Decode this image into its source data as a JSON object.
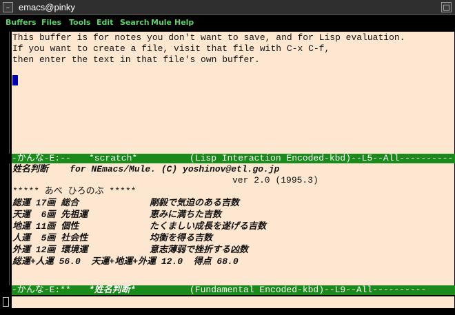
{
  "window": {
    "title": "emacs@pinky",
    "menu_button_glyph": "–",
    "close_button_glyph": "□"
  },
  "menubar": {
    "items": [
      "Buffers",
      "Files",
      "Tools",
      "Edit",
      "Search",
      "Mule",
      "Help"
    ]
  },
  "scratch_buffer": {
    "lines": [
      "This buffer is for notes you don't want to save, and for Lisp evaluation.",
      "If you want to create a file, visit that file with C-x C-f,",
      "then enter the text in that file's own buffer."
    ]
  },
  "modeline_top": {
    "status": "-かんな-E:--",
    "buffer": "*scratch*",
    "mode": "(Lisp Interaction Encoded-kbd)--L5--All----------"
  },
  "seimei_buffer": {
    "header_line": "姓名判断    for NEmacs/Mule. (C) yoshinov@etl.go.jp",
    "version_line": "ver 2.0 (1995.3)",
    "name_line": "***** あべ ひろのぶ *****",
    "rows": [
      {
        "label": "総運 17画 総合",
        "desc": "剛毅で気迫のある吉数"
      },
      {
        "label": "天運  6画 先祖運",
        "desc": "恵みに満ちた吉数"
      },
      {
        "label": "地運 11画 個性",
        "desc": "たくましい成長を遂げる吉数"
      },
      {
        "label": "人運  5画 社会性",
        "desc": "均衡を得る吉数"
      },
      {
        "label": "外運 12画 環境運",
        "desc": "意志薄弱で挫折する凶数"
      }
    ],
    "summary_line": "総運+人運 56.0  天運+地運+外運 12.0  得点 68.0"
  },
  "modeline_bottom": {
    "status": "-かんな-E:**",
    "buffer": "*姓名判断*",
    "mode": "(Fundamental Encoded-kbd)--L9--All----------"
  },
  "colors": {
    "buffer_bg": "#fee7d0",
    "modeline_bg": "#1a8a1a",
    "menu_text": "#5fcf6a",
    "cursor": "#0000aa"
  }
}
